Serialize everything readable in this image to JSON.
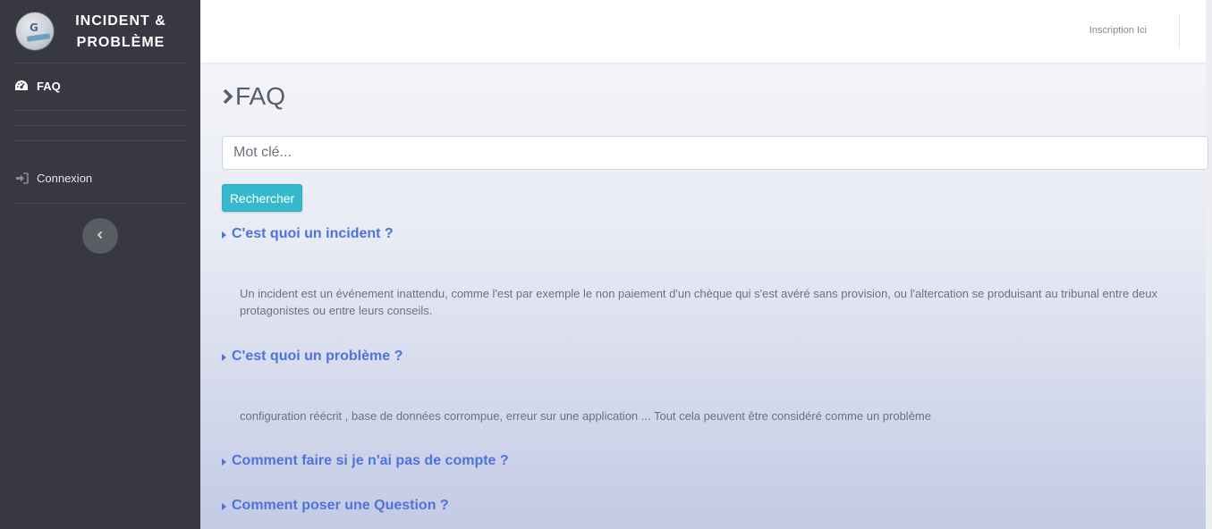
{
  "brand": {
    "title_line1": "INCIDENT &",
    "title_line2": "PROBLÈME",
    "logo_letter": "G"
  },
  "sidebar": {
    "items": [
      {
        "label": "FAQ",
        "icon": "tachometer-icon"
      },
      {
        "label": "Connexion",
        "icon": "sign-in-icon"
      }
    ],
    "toggle_icon": "chevron-left-icon"
  },
  "topbar": {
    "link_label": "Inscription Ici"
  },
  "page": {
    "title": "FAQ"
  },
  "search": {
    "placeholder": "Mot clé...",
    "button_label": "Rechercher"
  },
  "faq": [
    {
      "question": "C'est quoi un incident ?",
      "answer": "Un incident est un événement inattendu, comme l'est par exemple le non paiement d'un chèque qui s'est avéré sans provision, ou l'altercation se produisant au tribunal entre deux protagonistes ou entre leurs conseils."
    },
    {
      "question": "C'est quoi un problème ?",
      "answer": "configuration réécrit , base de données corrompue, erreur sur une application ... Tout cela peuvent être considéré comme un problème"
    },
    {
      "question": "Comment faire si je n'ai pas de compte ?",
      "answer": ""
    },
    {
      "question": "Comment poser une Question ?",
      "answer": ""
    }
  ],
  "colors": {
    "sidebar_bg": "#373841",
    "accent": "#4e73df",
    "button": "#36b9cc",
    "text_muted": "#6e707e"
  }
}
